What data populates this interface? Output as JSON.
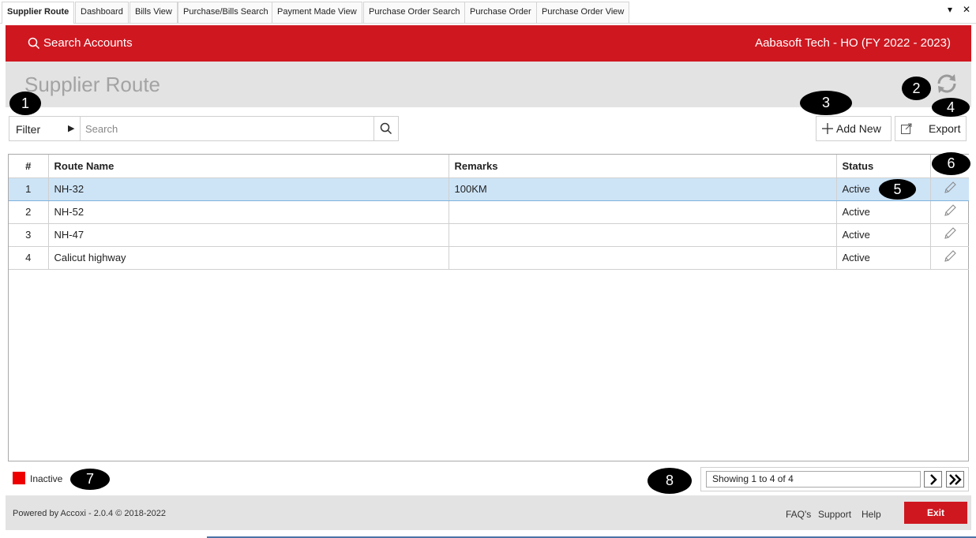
{
  "tabs": [
    {
      "label": "Supplier Route",
      "active": true
    },
    {
      "label": "Dashboard"
    },
    {
      "label": "Bills View"
    },
    {
      "label": "Purchase/Bills Search"
    },
    {
      "label": "Payment Made View"
    },
    {
      "label": "Purchase Order Search"
    },
    {
      "label": "Purchase Order"
    },
    {
      "label": "Purchase Order View"
    }
  ],
  "tabbar": {
    "dropdown_glyph": "▾",
    "close_glyph": "✕"
  },
  "header": {
    "search_label": "Search Accounts",
    "company": "Aabasoft Tech - HO (FY 2022 - 2023)",
    "color": "#cf1720"
  },
  "page": {
    "title": "Supplier Route"
  },
  "toolbar": {
    "filter_label": "Filter",
    "search_placeholder": "Search",
    "add_new_label": "Add New",
    "export_label": "Export"
  },
  "table": {
    "columns": [
      "#",
      "Route Name",
      "Remarks",
      "Status",
      ""
    ],
    "rows": [
      {
        "num": "1",
        "route": "NH-32",
        "remarks": "100KM",
        "status": "Active"
      },
      {
        "num": "2",
        "route": "NH-52",
        "remarks": "",
        "status": "Active"
      },
      {
        "num": "3",
        "route": "NH-47",
        "remarks": "",
        "status": "Active"
      },
      {
        "num": "4",
        "route": "Calicut highway",
        "remarks": "",
        "status": "Active"
      }
    ],
    "selected_row": 0,
    "selected_color": "#cde4f7"
  },
  "legend": {
    "label": "Inactive",
    "color": "#ee0000"
  },
  "pager": {
    "info": "Showing 1 to 4 of 4"
  },
  "footer": {
    "powered": "Powered by Accoxi - 2.0.4 © 2018-2022",
    "faq": "FAQ's",
    "support": "Support",
    "help": "Help",
    "exit": "Exit"
  },
  "callouts": [
    "1",
    "2",
    "3",
    "4",
    "5",
    "6",
    "7",
    "8"
  ]
}
